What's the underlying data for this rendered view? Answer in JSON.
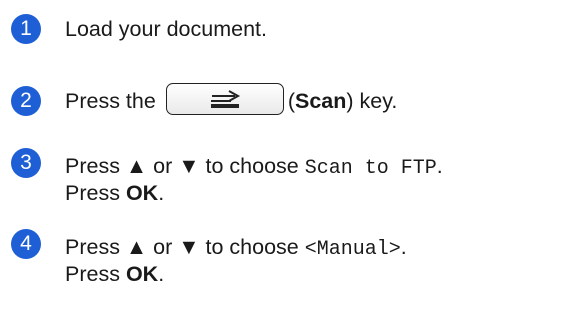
{
  "accent_color": "#1f5fd6",
  "steps": [
    {
      "number": "1",
      "text": "Load your document."
    },
    {
      "number": "2",
      "pre": "Press the",
      "key_icon": "scan-key-icon",
      "open_paren": "(",
      "key_name": "Scan",
      "post": ") key."
    },
    {
      "number": "3",
      "l1_pre": "Press ▲ or ▼ to choose ",
      "l1_mono": "Scan to FTP",
      "l1_post": ".",
      "l2_pre": "Press ",
      "l2_bold": "OK",
      "l2_post": "."
    },
    {
      "number": "4",
      "l1_pre": "Press ▲ or ▼ to choose ",
      "l1_mono": "<Manual>",
      "l1_post": ".",
      "l2_pre": "Press ",
      "l2_bold": "OK",
      "l2_post": "."
    }
  ]
}
